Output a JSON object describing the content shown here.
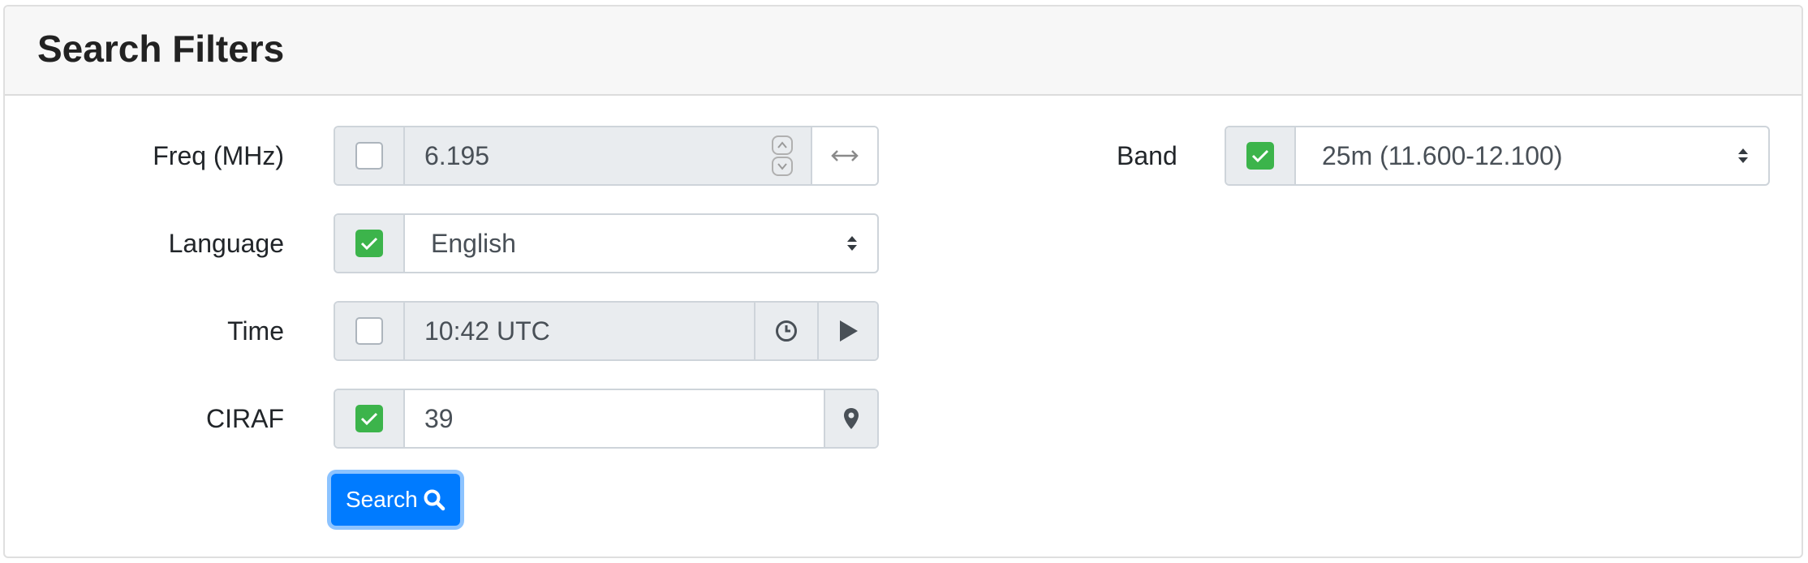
{
  "header": {
    "title": "Search Filters"
  },
  "filters": {
    "freq": {
      "label": "Freq (MHz)",
      "value": "6.195",
      "checked": false
    },
    "language": {
      "label": "Language",
      "value": "English",
      "checked": true
    },
    "time": {
      "label": "Time",
      "value": "10:42 UTC",
      "checked": false
    },
    "ciraf": {
      "label": "CIRAF",
      "value": "39",
      "checked": true
    },
    "band": {
      "label": "Band",
      "value": "25m (11.600-12.100)",
      "checked": true
    }
  },
  "search_button": {
    "label": "Search"
  },
  "colors": {
    "accent": "#007bff",
    "checked": "#3cb44b",
    "addon_bg": "#e9ecef"
  },
  "icons": {
    "freq_append": "double-arrow-icon",
    "time_clock": "clock-icon",
    "time_play": "play-icon",
    "ciraf_append": "map-marker-icon",
    "search": "search-icon"
  }
}
